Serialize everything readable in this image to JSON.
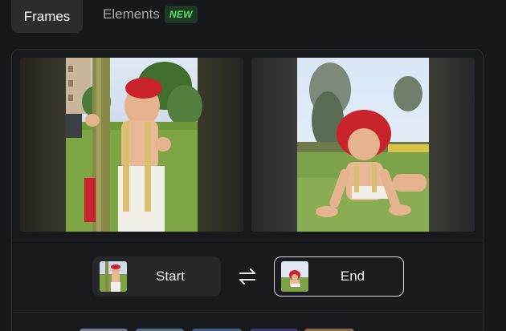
{
  "tabs": {
    "frames_label": "Frames",
    "elements_label": "Elements",
    "elements_badge": "NEW"
  },
  "frames": {
    "start_label": "Start",
    "end_label": "End",
    "swap_icon": "swap-arrows-icon"
  },
  "colors": {
    "background": "#17181b",
    "active_tab": "#2b2c30",
    "badge_bg": "#1f3a24",
    "badge_text": "#57e06a",
    "end_border": "#d9d9db"
  }
}
